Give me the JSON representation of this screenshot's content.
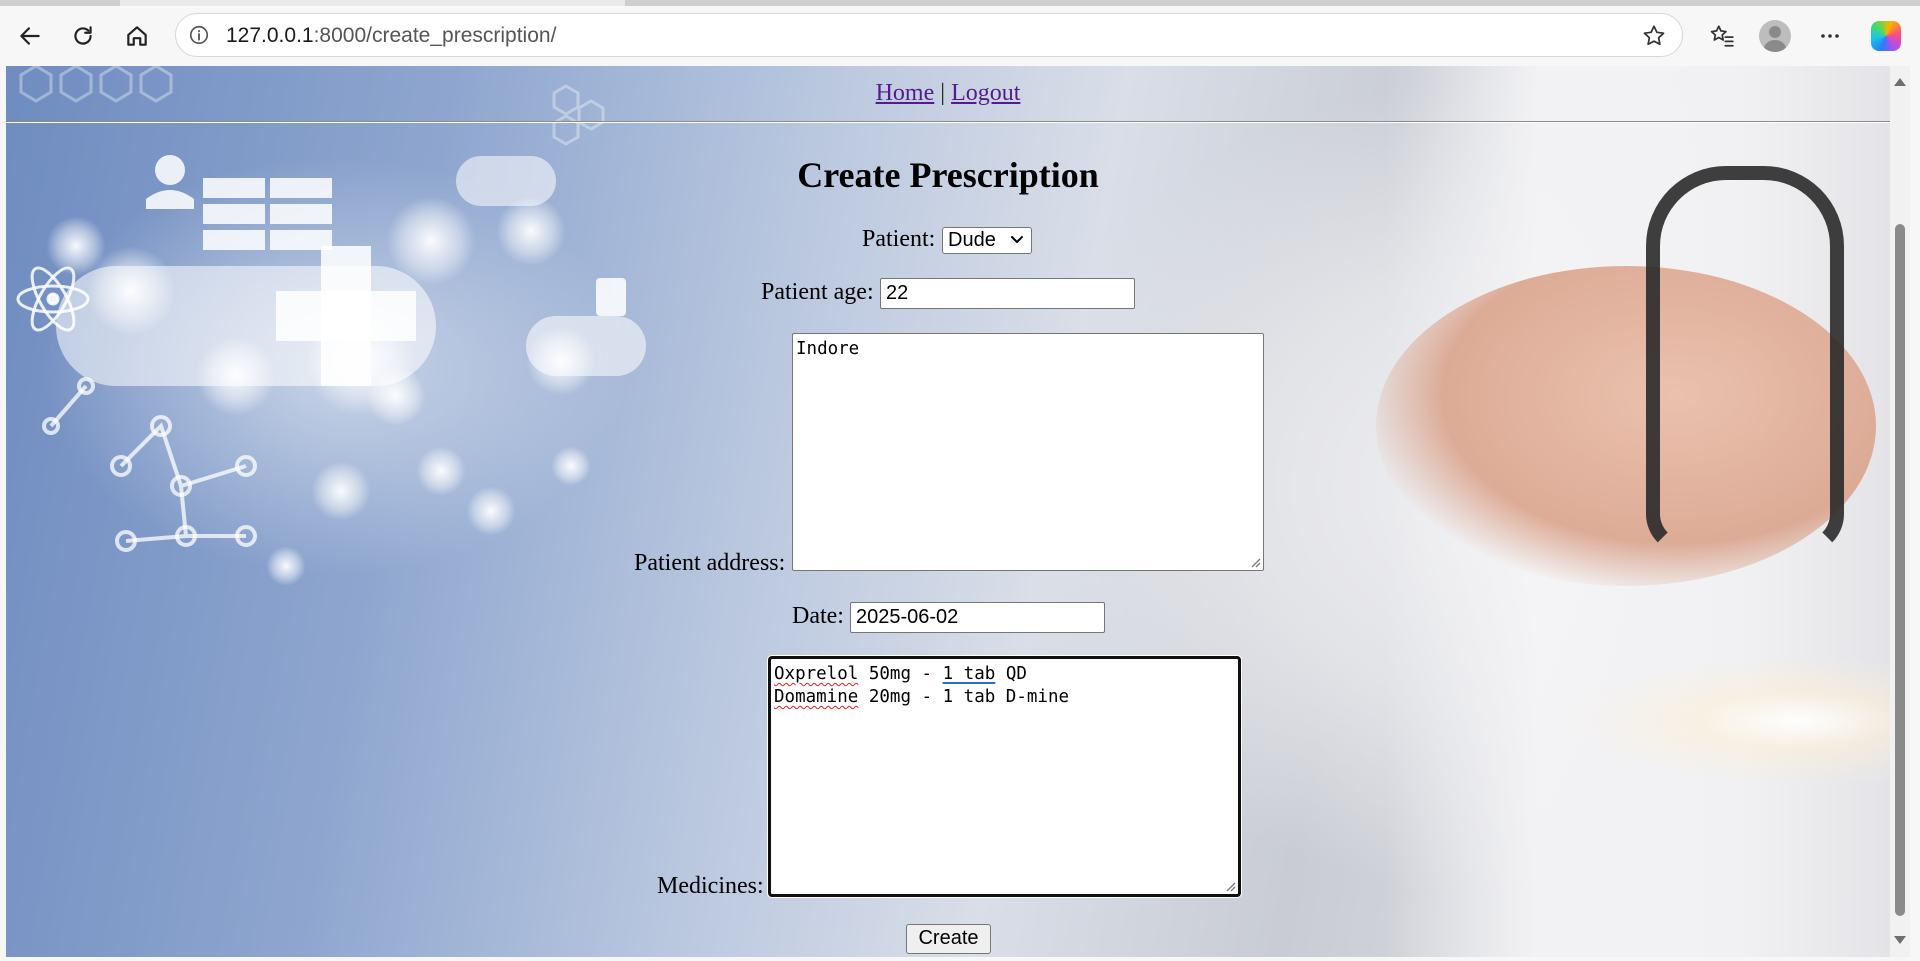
{
  "browser": {
    "url_host": "127.0.0.1",
    "url_path": ":8000/create_prescription/",
    "icons": {
      "back": "back-arrow-icon",
      "reload": "reload-icon",
      "home": "home-icon",
      "site_info": "info-icon",
      "favorite": "star-icon",
      "favorites_list": "favorites-icon",
      "profile": "avatar-icon",
      "menu": "more-dots-icon",
      "copilot": "copilot-icon"
    }
  },
  "nav": {
    "home": "Home",
    "separator": "|",
    "logout": "Logout"
  },
  "form": {
    "title": "Create Prescription",
    "patient_label": "Patient:",
    "patient_value": "Dude",
    "age_label": "Patient age:",
    "age_value": "22",
    "address_label": "Patient address:",
    "address_value": "Indore",
    "date_label": "Date:",
    "date_value": "2025-06-02",
    "medicines_label": "Medicines:",
    "medicines": [
      {
        "name": "Oxprelol",
        "rest_a": " 50mg - ",
        "underlined": "1 tab",
        "rest_b": " QD"
      },
      {
        "name": "Domamine",
        "rest": " 20mg - 1 tab D-mine"
      }
    ],
    "submit_label": "Create"
  },
  "colors": {
    "link": "#551a8b",
    "page_bg_blue": "#6f8cc0",
    "spell_error": "#e02020"
  }
}
